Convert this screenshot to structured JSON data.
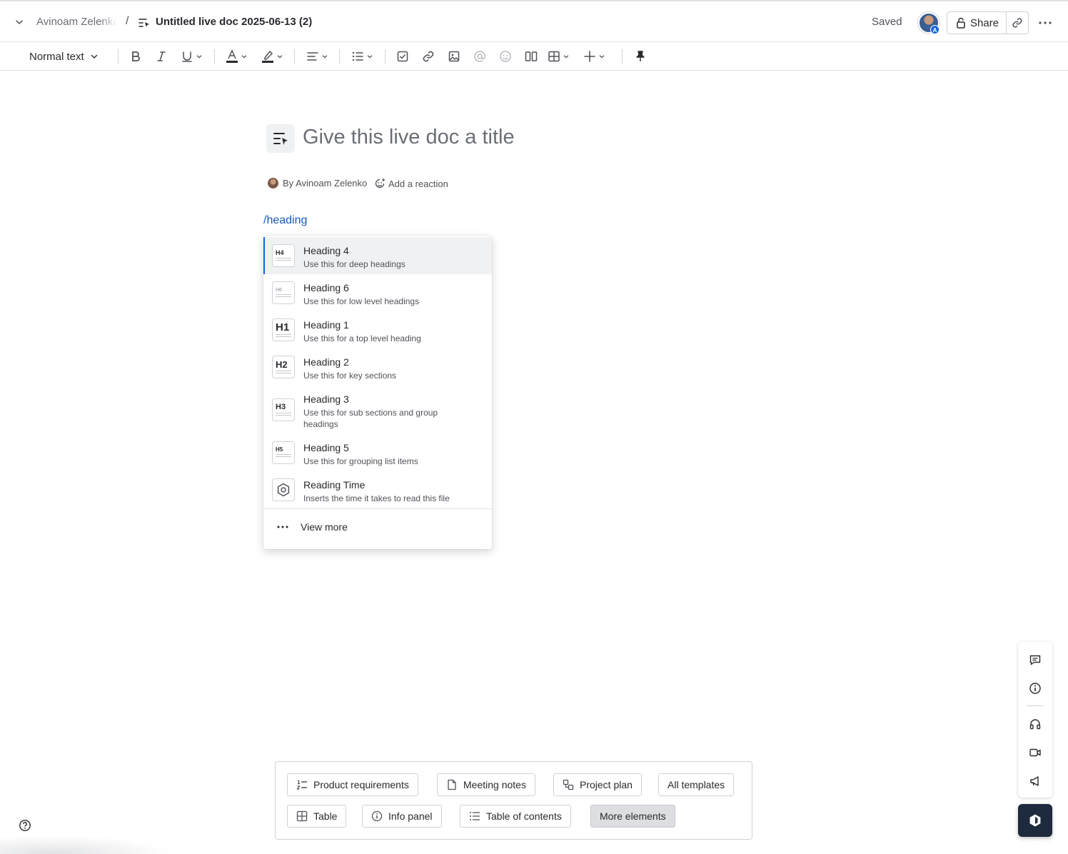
{
  "header": {
    "space_name": "Avinoam Zelenko",
    "separator": "/",
    "doc_name": "Untitled live doc 2025-06-13 (2)",
    "saved_status": "Saved",
    "avatar_badge": "A",
    "share_label": "Share"
  },
  "toolbar": {
    "text_style": "Normal text",
    "icons": [
      "bold-icon",
      "italic-icon",
      "underline-icon",
      "text-color-icon",
      "highlight-icon",
      "align-icon",
      "list-icon",
      "checkbox-icon",
      "link-icon",
      "image-icon",
      "mention-icon",
      "emoji-icon",
      "layout-icon",
      "table-icon",
      "insert-icon",
      "pin-icon"
    ]
  },
  "document": {
    "title_placeholder": "Give this live doc a title",
    "byline": "By Avinoam Zelenko",
    "reaction_label": "Add a reaction",
    "slash_command": "/heading"
  },
  "menu": {
    "items": [
      {
        "icon_label": "H4",
        "title": "Heading 4",
        "description": "Use this for deep headings"
      },
      {
        "icon_label": "H6",
        "title": "Heading 6",
        "description": "Use this for low level headings"
      },
      {
        "icon_label": "H1",
        "title": "Heading 1",
        "description": "Use this for a top level heading"
      },
      {
        "icon_label": "H2",
        "title": "Heading 2",
        "description": "Use this for key sections"
      },
      {
        "icon_label": "H3",
        "title": "Heading 3",
        "description": "Use this for sub sections and group headings"
      },
      {
        "icon_label": "H5",
        "title": "Heading 5",
        "description": "Use this for grouping list items"
      },
      {
        "icon_label": "",
        "title": "Reading Time",
        "description": "Inserts the time it takes to read this file"
      }
    ],
    "view_more": "View more"
  },
  "templates": {
    "row1": [
      "Product requirements",
      "Meeting notes",
      "Project plan",
      "All templates"
    ],
    "row2": [
      "Table",
      "Info panel",
      "Table of contents",
      "More elements"
    ]
  },
  "right_rail": [
    "comment-icon",
    "info-icon",
    "headphones-icon",
    "video-icon",
    "megaphone-icon"
  ]
}
